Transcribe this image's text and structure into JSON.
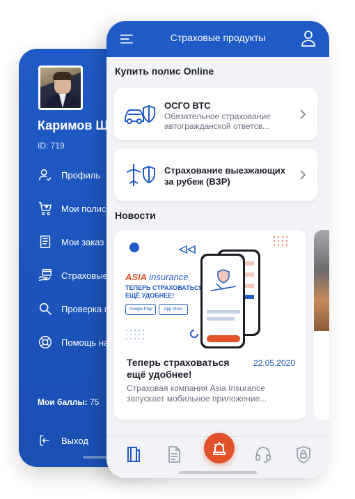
{
  "side_menu": {
    "user_name": "Каримов Ш",
    "user_id": "ID: 719",
    "items": [
      {
        "label": "Профиль",
        "icon": "profile-check-icon"
      },
      {
        "label": "Мои полис",
        "icon": "cart-plus-icon"
      },
      {
        "label": "Мои заказ",
        "icon": "document-list-icon"
      },
      {
        "label": "Страховые",
        "icon": "hand-card-icon"
      },
      {
        "label": "Проверка п",
        "icon": "search-icon"
      },
      {
        "label": "Помощь на",
        "icon": "lifebuoy-icon"
      }
    ],
    "points_label": "Мои баллы:",
    "points_value": "75",
    "logout_label": "Выход"
  },
  "header": {
    "title": "Страховые продукты"
  },
  "buy_section": {
    "title": "Купить полис Online",
    "cards": [
      {
        "title": "ОСГО ВТС",
        "desc_line1": "Обязательное страхование",
        "desc_line2": "автогражданской ответсв..."
      },
      {
        "title_line1": "Страхование выезжающих",
        "title_line2": "за рубеж (ВЗР)"
      }
    ]
  },
  "news_section": {
    "title": "Новости",
    "items": [
      {
        "banner_brand": "ASIA",
        "banner_brand_suffix": "insurance",
        "banner_slogan": "ТЕПЕРЬ СТРАХОВАТЬСЯ ЕЩЁ УДОБНЕЕ!",
        "google_play": "Google Play",
        "app_store": "App Store",
        "headline": "Теперь страховаться ещё удобнее!",
        "date": "22.05.2020",
        "text": "Страховая компания Asia Insurance запускает мобильное приложение..."
      }
    ]
  },
  "tabbar": {
    "tabs": [
      "book-icon",
      "document-icon",
      "siren-icon",
      "headset-icon",
      "lock-shield-icon"
    ],
    "active_color": "#1f5bc6",
    "center_color": "#e2532c"
  },
  "colors": {
    "primary": "#1f5bc6",
    "accent": "#e2532c",
    "background": "#f2f3f6"
  }
}
